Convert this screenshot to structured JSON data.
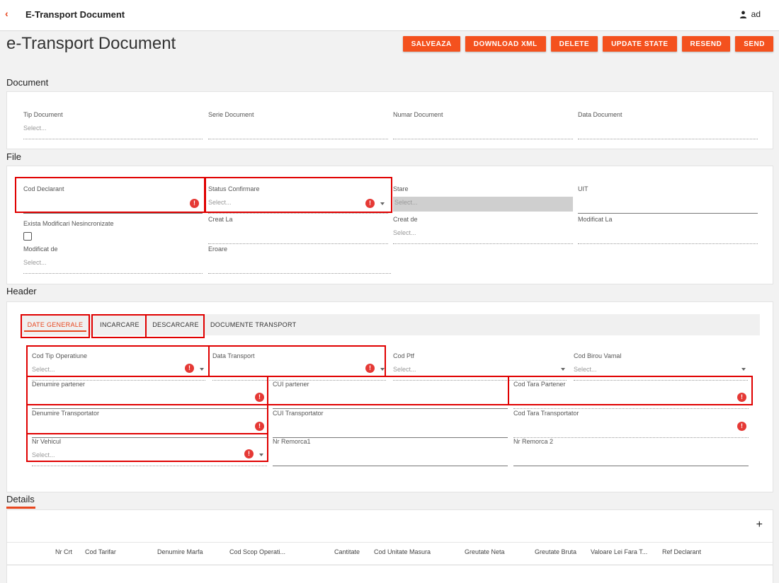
{
  "app": {
    "title": "E-Transport Document",
    "user": "ad"
  },
  "page_title": "e-Transport Document",
  "buttons": [
    "SALVEAZA",
    "DOWNLOAD XML",
    "DELETE",
    "UPDATE STATE",
    "RESEND",
    "SEND"
  ],
  "sections": {
    "document": "Document",
    "file": "File",
    "header": "Header",
    "details": "Details"
  },
  "document": {
    "tip_document": {
      "label": "Tip Document",
      "value": "Select..."
    },
    "serie_document": {
      "label": "Serie Document",
      "value": ""
    },
    "numar_document": {
      "label": "Numar Document",
      "value": ""
    },
    "data_document": {
      "label": "Data Document",
      "value": ""
    }
  },
  "file": {
    "cod_declarant": {
      "label": "Cod Declarant",
      "value": ""
    },
    "status_confirmare": {
      "label": "Status Confirmare",
      "value": "Select..."
    },
    "stare": {
      "label": "Stare",
      "value": "Select..."
    },
    "uit": {
      "label": "UIT",
      "value": ""
    },
    "exista_modificari": {
      "label": "Exista Modificari Nesincronizate",
      "checked": false
    },
    "creat_la": {
      "label": "Creat La",
      "value": ""
    },
    "creat_de": {
      "label": "Creat de",
      "value": "Select..."
    },
    "modificat_la": {
      "label": "Modificat La",
      "value": ""
    },
    "modificat_de": {
      "label": "Modificat de",
      "value": "Select..."
    },
    "eroare": {
      "label": "Eroare",
      "value": ""
    }
  },
  "header": {
    "tabs": [
      "DATE GENERALE",
      "INCARCARE",
      "DESCARCARE",
      "DOCUMENTE TRANSPORT"
    ],
    "active_tab": "DATE GENERALE",
    "cod_tip_operatiune": {
      "label": "Cod Tip Operatiune",
      "value": "Select..."
    },
    "data_transport": {
      "label": "Data Transport",
      "value": ""
    },
    "cod_ptf": {
      "label": "Cod Ptf",
      "value": "Select..."
    },
    "cod_birou_vamal": {
      "label": "Cod Birou Vamal",
      "value": "Select..."
    },
    "denumire_partener": {
      "label": "Denumire partener",
      "value": ""
    },
    "cui_partener": {
      "label": "CUI partener",
      "value": ""
    },
    "cod_tara_partener": {
      "label": "Cod Tara Partener",
      "value": ""
    },
    "denumire_transportator": {
      "label": "Denumire Transportator",
      "value": ""
    },
    "cui_transportator": {
      "label": "CUI Transportator",
      "value": ""
    },
    "cod_tara_transportator": {
      "label": "Cod Tara Transportator",
      "value": ""
    },
    "nr_vehicul": {
      "label": "Nr Vehicul",
      "value": "Select..."
    },
    "nr_remorca1": {
      "label": "Nr Remorca1",
      "value": ""
    },
    "nr_remorca2": {
      "label": "Nr Remorca 2",
      "value": ""
    }
  },
  "details": {
    "add_symbol": "+",
    "columns": [
      "Nr Crt",
      "Cod Tarifar",
      "Denumire Marfa",
      "Cod Scop Operati...",
      "Cantitate",
      "Cod Unitate Masura",
      "Greutate Neta",
      "Greutate Bruta",
      "Valoare Lei Fara T...",
      "Ref Declarant"
    ]
  },
  "icons": {
    "back": "chevron-left-icon",
    "user": "person-icon",
    "error": "error-icon",
    "dropdown": "caret-down-icon",
    "add": "plus-icon"
  },
  "colors": {
    "accent": "#f4511e",
    "error": "#e53935",
    "highlight_box": "#e00000"
  }
}
